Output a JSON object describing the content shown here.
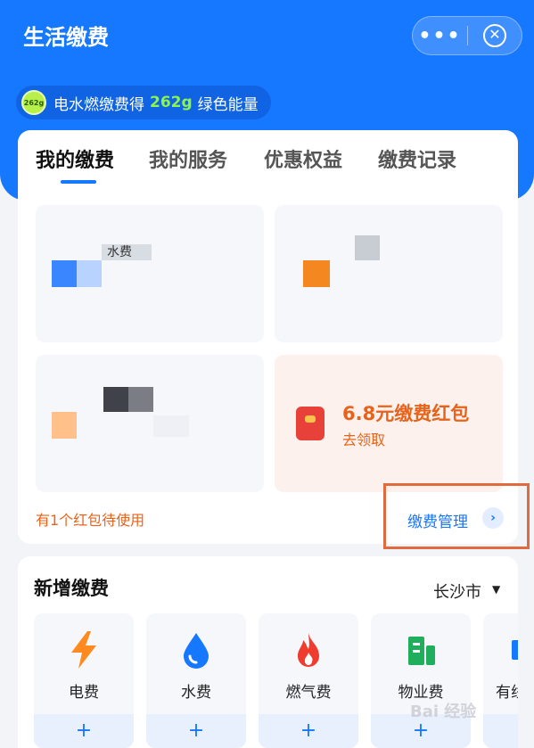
{
  "header": {
    "title": "生活缴费",
    "more_glyph": "•••",
    "close_glyph": "✕"
  },
  "energy": {
    "badge": "262g",
    "prefix": "电水燃缴费得",
    "amount": "262g",
    "suffix": "绿色能量"
  },
  "tabs": [
    {
      "label": "我的缴费",
      "active": true
    },
    {
      "label": "我的服务",
      "active": false
    },
    {
      "label": "优惠权益",
      "active": false
    },
    {
      "label": "缴费记录",
      "active": false
    }
  ],
  "tiles": {
    "tile1_fragment": "水费",
    "promo_title": "6.8元缴费红包",
    "promo_sub": "去领取"
  },
  "footer": {
    "pending": "有1个红包待使用",
    "manage": "缴费管理",
    "manage_arrow": "›"
  },
  "add": {
    "title": "新增缴费",
    "city": "长沙市",
    "city_caret": "▼",
    "plus": "+",
    "services": [
      {
        "label": "电费",
        "icon": "lightning-icon",
        "color": "#ff8a1f"
      },
      {
        "label": "水费",
        "icon": "water-drop-icon",
        "color": "#1677ff"
      },
      {
        "label": "燃气费",
        "icon": "flame-icon",
        "color": "#f03b2f"
      },
      {
        "label": "物业费",
        "icon": "building-icon",
        "color": "#1fae5b"
      },
      {
        "label": "有线",
        "icon": "tv-icon",
        "color": "#1677ff"
      }
    ]
  },
  "watermark": "Bai 经验",
  "colors": {
    "primary": "#1677ff",
    "accent_orange": "#e8631a",
    "highlight_box": "#e26a3f"
  }
}
